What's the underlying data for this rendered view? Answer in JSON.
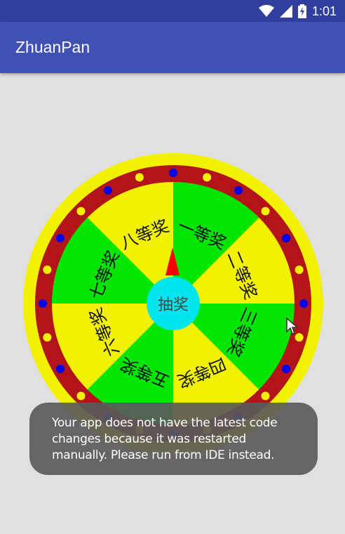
{
  "status_bar": {
    "time": "1:01",
    "icons": [
      "wifi-icon",
      "signal-icon",
      "battery-icon"
    ]
  },
  "app_bar": {
    "title": "ZhuanPan"
  },
  "wheel": {
    "center_button_label": "抽奖",
    "segments": [
      "一等奖",
      "二等奖",
      "三等奖",
      "四等奖",
      "五等奖",
      "六等奖",
      "七等奖",
      "八等奖"
    ],
    "colors": {
      "outer_ring": "#f2f200",
      "red_ring": "#b3141a",
      "segment_yellow": "#f2f200",
      "segment_green": "#00e600",
      "center": "#00e6ee",
      "pointer": "#ff0000",
      "dot_blue": "#0000ee",
      "dot_yellow": "#f2f200"
    }
  },
  "toast": {
    "message": "Your app does not have the latest code changes because it was restarted manually. Please run from IDE instead."
  }
}
